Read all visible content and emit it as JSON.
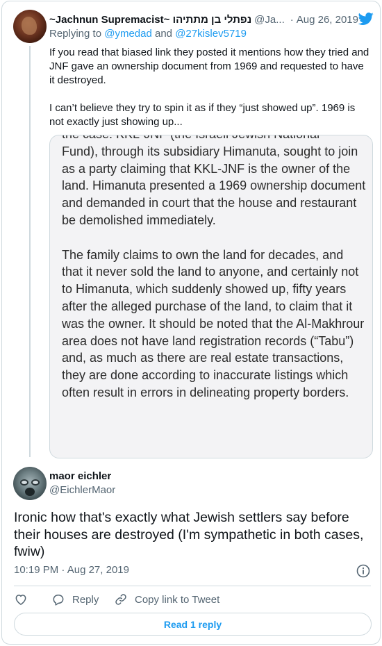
{
  "parent_tweet": {
    "author_name": "~Jachnun Supremacist~ נפתלי בן מתתיהו",
    "handle": "@Ja...",
    "date": "Aug 26, 2019",
    "replying_to_prefix": "Replying to",
    "replying_to_user1": "@ymedad",
    "replying_to_and": "and",
    "replying_to_user2": "@27kislev5719",
    "text_p1": "If you read that biased link they posted it mentions how they tried and JNF gave an ownership document from 1969 and requested to have it destroyed.",
    "text_p2": "I can’t believe they try to spin it as if they “just showed up”. 1969 is not exactly just showing up...",
    "quoted_image": {
      "partial_top_line": "the case. KKL-JNF (the Israeli Jewish National",
      "paragraph1_rest": "Fund), through its subsidiary Himanuta, sought to join as a party claiming that KKL-JNF is the owner of the land. Himanuta presented a 1969 ownership document and demanded in court that the house and restaurant be demolished immediately.",
      "paragraph2": "The family claims to own the land for decades, and that it never sold the land to anyone, and certainly not to Himanuta, which suddenly showed up, fifty years after the alleged purchase of the land, to claim that it was the owner. It should be noted that the Al-Makhrour area does not have land registration records (“Tabu”) and, as much as there are real estate transactions, they are done according to inaccurate listings which often result in errors in delineating property borders."
    }
  },
  "main_tweet": {
    "author_name": "maor eichler",
    "handle": "@EichlerMaor",
    "text": "Ironic how that's exactly what Jewish settlers say before their houses are destroyed (I'm sympathetic in both cases, fwiw)",
    "time": "10:19 PM",
    "separator": "·",
    "date": "Aug 27, 2019"
  },
  "actions": {
    "reply_label": "Reply",
    "copy_link_label": "Copy link to Tweet"
  },
  "read_replies_label": "Read 1 reply",
  "colors": {
    "accent": "#1d9bf0",
    "secondary_text": "#536471",
    "border": "#cfd9de"
  },
  "icons": [
    "twitter-bird-icon",
    "info-icon",
    "heart-icon",
    "reply-bubble-icon",
    "link-icon"
  ]
}
